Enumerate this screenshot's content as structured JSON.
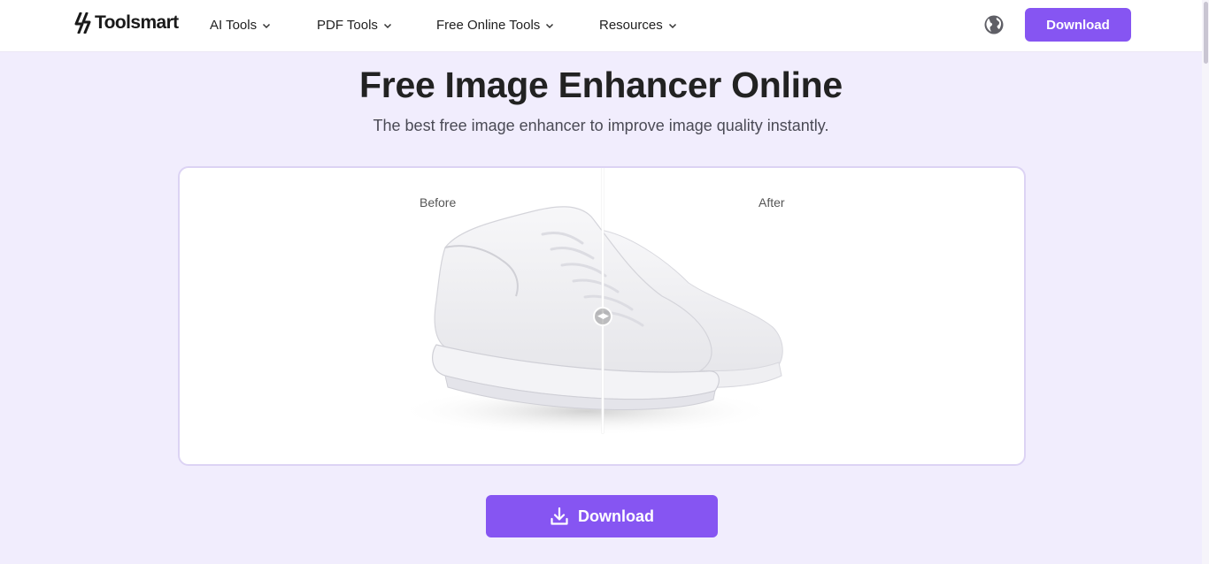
{
  "brand": {
    "name": "Toolsmart"
  },
  "nav": {
    "items": [
      {
        "label": "AI Tools"
      },
      {
        "label": "PDF Tools"
      },
      {
        "label": "Free Online Tools"
      },
      {
        "label": "Resources"
      }
    ]
  },
  "header": {
    "download_label": "Download"
  },
  "hero": {
    "title": "Free Image Enhancer Online",
    "subtitle": "The best free image enhancer to improve image quality instantly."
  },
  "compare": {
    "before_label": "Before",
    "after_label": "After"
  },
  "cta": {
    "download_label": "Download"
  },
  "icons": {
    "logo": "lightning-bolt-logo",
    "language": "globe-icon",
    "dropdown": "chevron-down-icon",
    "download": "download-icon",
    "slider": "compare-slider-icon"
  },
  "colors": {
    "accent": "#8655f2",
    "page_background": "#f1edfd",
    "card_border": "#dcd3f4"
  }
}
